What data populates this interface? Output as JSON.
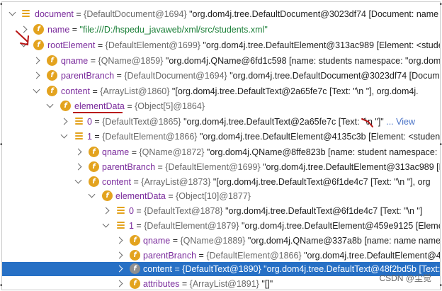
{
  "rows": [
    {
      "name": "document",
      "type": "{DefaultDocument@1694}",
      "value": "\"org.dom4j.tree.DefaultDocument@3023df74 [Document: name fi"
    },
    {
      "name": "name",
      "value": "\"file:///D:/hspedu_javaweb/xml/src/students.xml\""
    },
    {
      "name": "rootElement",
      "type": "{DefaultElement@1699}",
      "value": "\"org.dom4j.tree.DefaultElement@313ac989 [Element: <student"
    },
    {
      "name": "qname",
      "type": "{QName@1859}",
      "value": "\"org.dom4j.QName@6fd1c598 [name: students namespace: \"org.dom4j."
    },
    {
      "name": "parentBranch",
      "type": "{DefaultDocument@1694}",
      "value": "\"org.dom4j.tree.DefaultDocument@3023df74 [Documen"
    },
    {
      "name": "content",
      "type": "{ArrayList@1860}",
      "value": "\"[org.dom4j.tree.DefaultText@2a65fe7c [Text: \"\\n     \"], org.dom4j."
    },
    {
      "name": "elementData",
      "type": "{Object[5]@1864}",
      "value": ""
    },
    {
      "name": "0",
      "type": "{DefaultText@1865}",
      "value": "\"org.dom4j.tree.DefaultText@2a65fe7c [Text: \"\\n     \"]\"",
      "link": "... View"
    },
    {
      "name": "1",
      "type": "{DefaultElement@1866}",
      "value": "\"org.dom4j.tree.DefaultElement@4135c3b [Element: <student a"
    },
    {
      "name": "qname",
      "type": "{QName@1872}",
      "value": "\"org.dom4j.QName@8ffe823b [name: student namespace: \"or"
    },
    {
      "name": "parentBranch",
      "type": "{DefaultElement@1699}",
      "value": "\"org.dom4j.tree.DefaultElement@313ac989 [Ele"
    },
    {
      "name": "content",
      "type": "{ArrayList@1873}",
      "value": "\"[org.dom4j.tree.DefaultText@6f1de4c7 [Text: \"\\n     \"], org"
    },
    {
      "name": "elementData",
      "type": "{Object[10]@1877}",
      "value": ""
    },
    {
      "name": "0",
      "type": "{DefaultText@1878}",
      "value": "\"org.dom4j.tree.DefaultText@6f1de4c7 [Text: \"\\n        \"]"
    },
    {
      "name": "1",
      "type": "{DefaultElement@1879}",
      "value": "\"org.dom4j.tree.DefaultElement@459e9125 [Element"
    },
    {
      "name": "qname",
      "type": "{QName@1889}",
      "value": "\"org.dom4j.QName@337a8b [name: name namesp"
    },
    {
      "name": "parentBranch",
      "type": "{DefaultElement@1866}",
      "value": "\"org.dom4j.tree.DefaultElement@413"
    },
    {
      "name": "content",
      "type": "{DefaultText@1890}",
      "value": "\"org.dom4j.tree.DefaultText@48f2bd5b [Text:"
    },
    {
      "name": "attributes",
      "type": "{ArrayList@1891}",
      "value": "\"[]\""
    }
  ],
  "watermark": "CSDN @尘觉",
  "colors": {
    "selection": "#2770c5",
    "field_icon": "#e3a31f",
    "annotation": "#b81414"
  }
}
